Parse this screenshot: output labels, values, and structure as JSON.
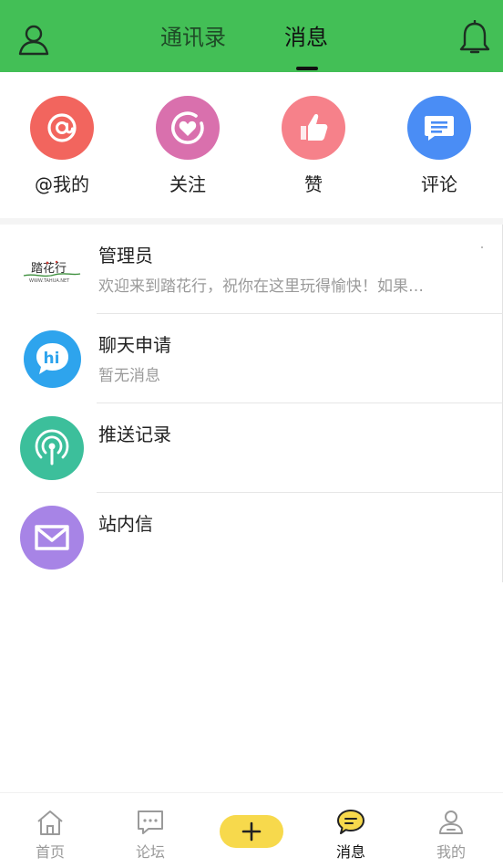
{
  "header": {
    "tabs": [
      {
        "label": "通讯录",
        "active": false
      },
      {
        "label": "消息",
        "active": true
      }
    ],
    "user_icon": "user-icon",
    "bell_icon": "bell-icon",
    "background_color": "#43bf56"
  },
  "quick_actions": [
    {
      "label": "@我的",
      "icon": "at-icon",
      "color": "#f2655e"
    },
    {
      "label": "关注",
      "icon": "heart-follow-icon",
      "color": "#d970ad"
    },
    {
      "label": "赞",
      "icon": "thumbs-up-icon",
      "color": "#f6818a"
    },
    {
      "label": "评论",
      "icon": "comment-icon",
      "color": "#4a8df5"
    }
  ],
  "messages": [
    {
      "title": "管理员",
      "preview": "欢迎来到踏花行，祝你在这里玩得愉快！如果…",
      "avatar": "tahuaxing-logo",
      "logo_text": "踏花行",
      "logo_url_text": "WWW.TAHUA.NET"
    },
    {
      "title": "聊天申请",
      "preview": "暂无消息",
      "avatar": "hi-chat-icon",
      "color": "#2ea4ed",
      "icon_text": "hi"
    },
    {
      "title": "推送记录",
      "preview": "",
      "avatar": "broadcast-icon",
      "color": "#3cbf9b"
    },
    {
      "title": "站内信",
      "preview": "",
      "avatar": "envelope-icon",
      "color": "#a784e6"
    }
  ],
  "tabbar": {
    "items": [
      {
        "label": "首页",
        "icon": "home-icon",
        "active": false
      },
      {
        "label": "论坛",
        "icon": "forum-icon",
        "active": false
      },
      {
        "label": "",
        "icon": "plus-icon",
        "active": false
      },
      {
        "label": "消息",
        "icon": "message-bubble-icon",
        "active": true
      },
      {
        "label": "我的",
        "icon": "profile-icon",
        "active": false
      }
    ],
    "plus_color": "#f7d94c"
  }
}
